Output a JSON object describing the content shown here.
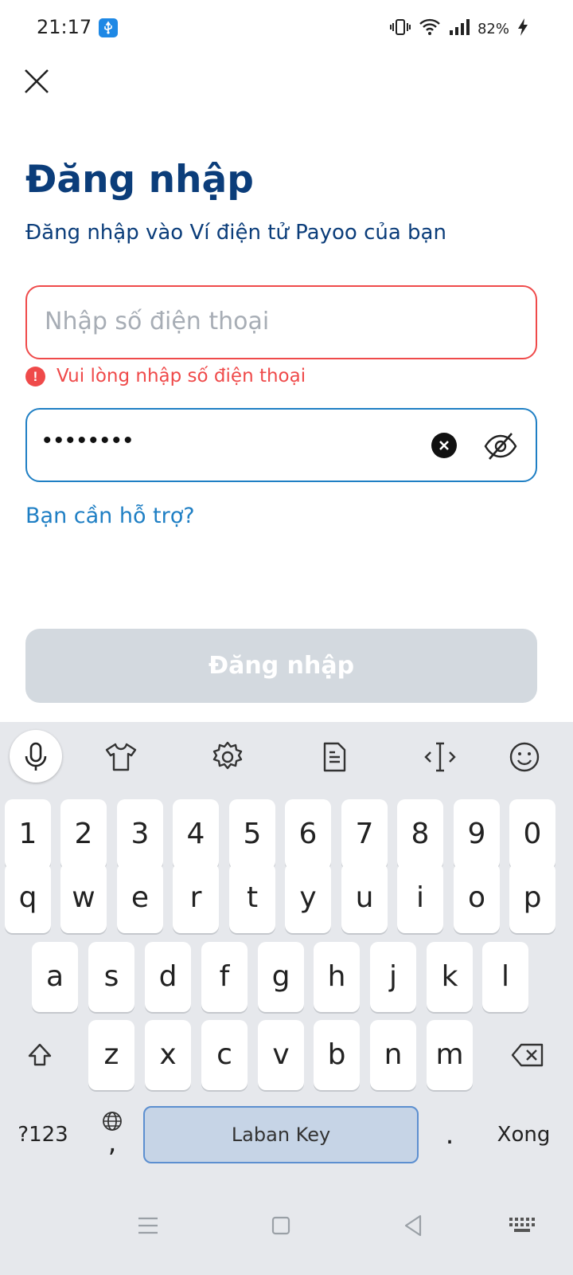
{
  "status": {
    "time": "21:17",
    "battery": "82%"
  },
  "header": {
    "close_icon": "close-icon"
  },
  "login": {
    "title": "Đăng nhập",
    "subtitle": "Đăng nhập vào Ví điện tử Payoo của bạn",
    "phone_placeholder": "Nhập số điện thoại",
    "phone_value": "",
    "phone_error": "Vui lòng nhập số điện thoại",
    "password_masked": "••••••••",
    "help_link": "Bạn cần hỗ trợ?",
    "submit_label": "Đăng nhập"
  },
  "colors": {
    "primary_dark": "#0b3d7a",
    "link_blue": "#1f7fc4",
    "error_red": "#ef4a4a",
    "disabled_button": "#d3d9df"
  },
  "keyboard": {
    "toolbar_icons": [
      "mic-icon",
      "shirt-icon",
      "gear-icon",
      "clipboard-icon",
      "cursor-icon",
      "emoji-icon"
    ],
    "row_numbers": [
      "1",
      "2",
      "3",
      "4",
      "5",
      "6",
      "7",
      "8",
      "9",
      "0"
    ],
    "row_1": [
      "q",
      "w",
      "e",
      "r",
      "t",
      "y",
      "u",
      "i",
      "o",
      "p"
    ],
    "row_2": [
      "a",
      "s",
      "d",
      "f",
      "g",
      "h",
      "j",
      "k",
      "l"
    ],
    "row_3": [
      "z",
      "x",
      "c",
      "v",
      "b",
      "n",
      "m"
    ],
    "symbols_key": "?123",
    "comma_key": ",",
    "space_label": "Laban Key",
    "period_key": ".",
    "done_key": "Xong"
  }
}
